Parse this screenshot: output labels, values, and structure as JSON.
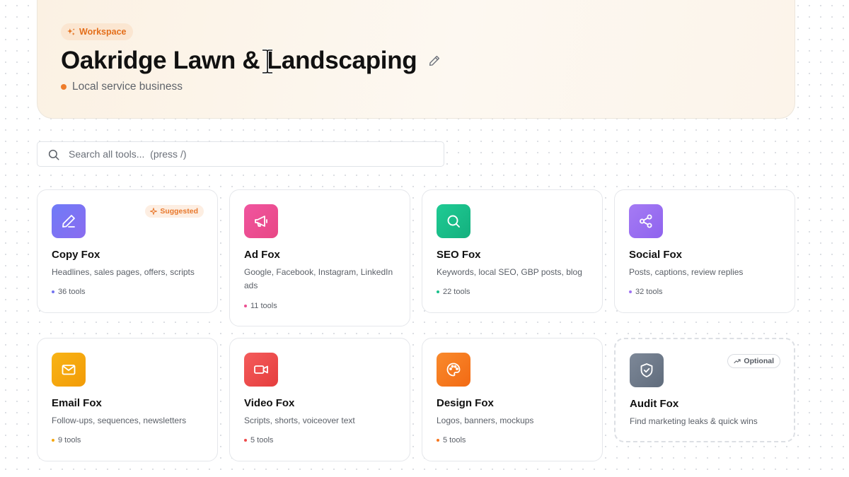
{
  "workspace": {
    "badge_label": "Workspace",
    "title": "Oakridge Lawn & Landscaping",
    "subtitle": "Local service business",
    "edit_icon": "pencil-icon",
    "accent_color": "#e46f1b"
  },
  "search": {
    "placeholder": "Search all tools...  (press /)",
    "value": "",
    "icon": "search-icon"
  },
  "cards": [
    {
      "title": "Copy Fox",
      "description": "Headlines, sales pages, offers, scripts",
      "count": "36 tools",
      "icon": "pen-icon",
      "color": "#7373f0",
      "badge": "Suggested"
    },
    {
      "title": "Ad Fox",
      "description": "Google, Facebook, Instagram, LinkedIn ads",
      "count": "11 tools",
      "icon": "megaphone-icon",
      "color": "#ec4f91"
    },
    {
      "title": "SEO Fox",
      "description": "Keywords, local SEO, GBP posts, blog",
      "count": "22 tools",
      "icon": "magnifier-icon",
      "color": "#19c08b"
    },
    {
      "title": "Social Fox",
      "description": "Posts, captions, review replies",
      "count": "32 tools",
      "icon": "share-icon",
      "color": "#9f72f1"
    },
    {
      "title": "Email Fox",
      "description": "Follow-ups, sequences, newsletters",
      "count": "9 tools",
      "icon": "envelope-icon",
      "color": "#f5a70c"
    },
    {
      "title": "Video Fox",
      "description": "Scripts, shorts, voiceover text",
      "count": "5 tools",
      "icon": "video-camera-icon",
      "color": "#ef4a4a"
    },
    {
      "title": "Design Fox",
      "description": "Logos, banners, mockups",
      "count": "5 tools",
      "icon": "palette-icon",
      "color": "#f7761f"
    },
    {
      "title": "Audit Fox",
      "description": "Find marketing leaks & quick wins",
      "icon": "shield-check-icon",
      "color": "#6e7b8b",
      "badge": "Optional"
    }
  ]
}
